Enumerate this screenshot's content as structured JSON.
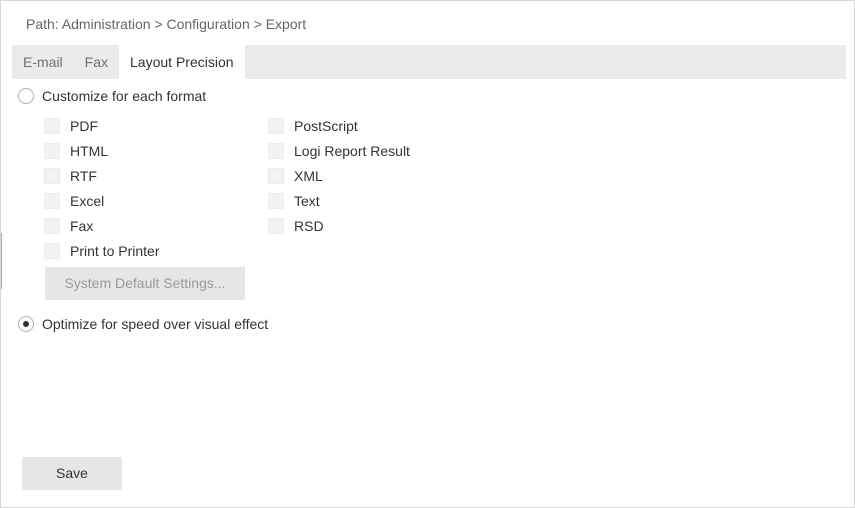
{
  "breadcrumb": {
    "text": "Path: Administration > Configuration > Export"
  },
  "tabs": [
    {
      "label": "E-mail",
      "active": false
    },
    {
      "label": "Fax",
      "active": false
    },
    {
      "label": "Layout Precision",
      "active": true
    }
  ],
  "options": {
    "customize": {
      "label": "Customize for each format",
      "selected": false
    },
    "optimize": {
      "label": "Optimize for speed over visual effect",
      "selected": true
    }
  },
  "formats_left": [
    {
      "label": "PDF",
      "checked": false,
      "enabled": false
    },
    {
      "label": "HTML",
      "checked": false,
      "enabled": false
    },
    {
      "label": "RTF",
      "checked": false,
      "enabled": false
    },
    {
      "label": "Excel",
      "checked": false,
      "enabled": false
    },
    {
      "label": "Fax",
      "checked": false,
      "enabled": false
    },
    {
      "label": "Print to Printer",
      "checked": false,
      "enabled": false
    }
  ],
  "formats_right": [
    {
      "label": "PostScript",
      "checked": false,
      "enabled": false
    },
    {
      "label": "Logi Report Result",
      "checked": false,
      "enabled": false
    },
    {
      "label": "XML",
      "checked": false,
      "enabled": false
    },
    {
      "label": "Text",
      "checked": false,
      "enabled": false
    },
    {
      "label": "RSD",
      "checked": false,
      "enabled": false
    }
  ],
  "buttons": {
    "system_default": {
      "label": "System Default Settings...",
      "enabled": false
    },
    "save": {
      "label": "Save",
      "enabled": true
    }
  }
}
